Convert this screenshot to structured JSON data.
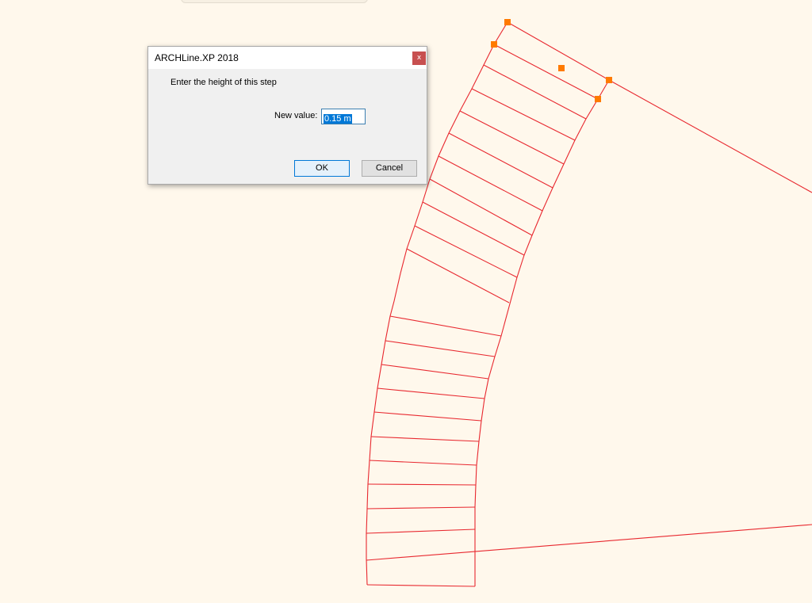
{
  "dialog": {
    "title": "ARCHLine.XP 2018",
    "close_label": "x",
    "prompt": "Enter the height of this step",
    "field_label": "New value:",
    "value": "0.15 m",
    "ok_label": "OK",
    "cancel_label": "Cancel"
  },
  "canvas": {
    "line_color": "#e8282f",
    "handle_color": "#ff7a00",
    "background_color": "#fff8ec"
  }
}
